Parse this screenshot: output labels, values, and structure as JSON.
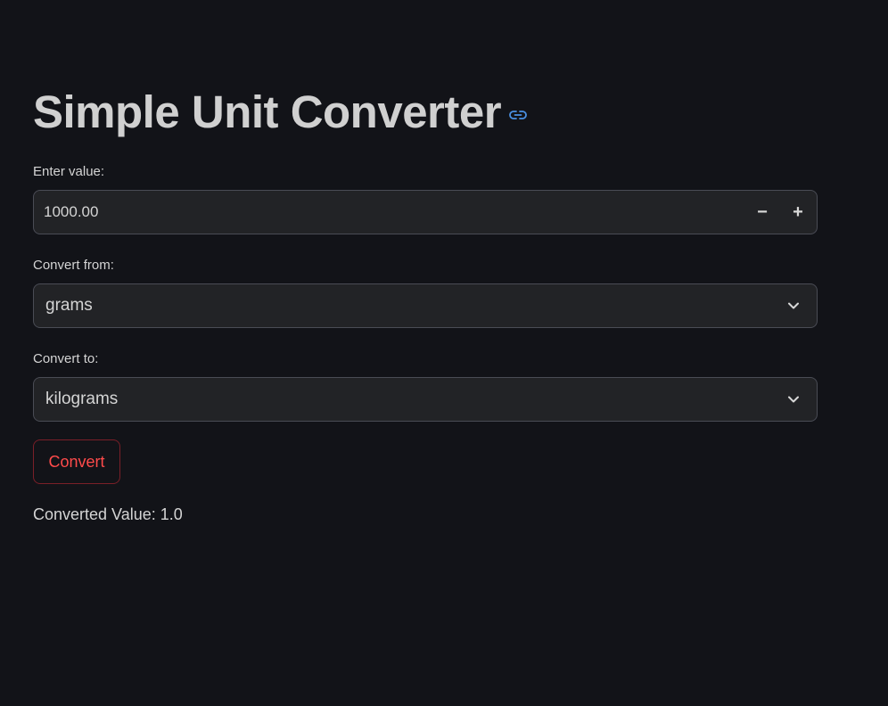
{
  "header": {
    "title": "Simple Unit Converter",
    "anchor_icon": "link-icon"
  },
  "value_field": {
    "label": "Enter value:",
    "value": "1000.00",
    "decrement_symbol": "−",
    "increment_symbol": "+"
  },
  "from_field": {
    "label": "Convert from:",
    "selected": "grams"
  },
  "to_field": {
    "label": "Convert to:",
    "selected": "kilograms"
  },
  "convert_button": {
    "label": "Convert"
  },
  "result": {
    "text": "Converted Value: 1.0"
  },
  "colors": {
    "background": "#121318",
    "input_background": "#222326",
    "input_border": "#4a4c55",
    "accent_red": "#ff4b4b",
    "link_blue": "#4a90e2"
  }
}
